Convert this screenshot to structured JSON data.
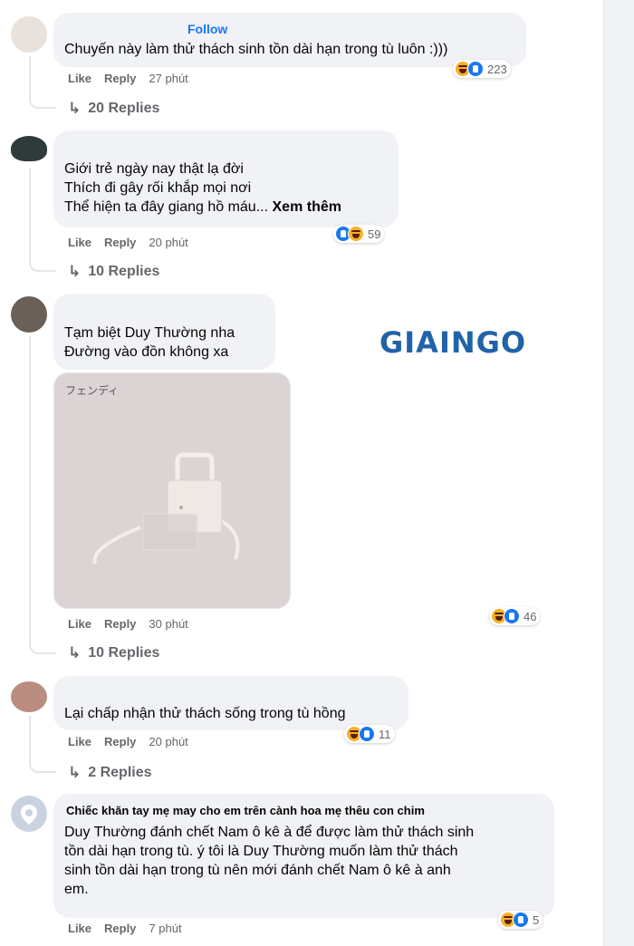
{
  "comments": [
    {
      "follow": "Follow",
      "lines": [
        "Chuyến này làm thử thách sinh tồn dài hạn trong tù luôn :)))"
      ],
      "actions": {
        "like": "Like",
        "reply": "Reply",
        "time": "27 phút"
      },
      "reactions": {
        "icons": [
          "haha-icon",
          "like-icon"
        ],
        "count": "223"
      },
      "replies": "20 Replies"
    },
    {
      "lines": [
        "Giới trẻ ngày nay thật lạ đời",
        "Thích đi gây rối khắp mọi nơi",
        "Thể hiện ta đây giang hồ máu..."
      ],
      "see_more": "Xem thêm",
      "actions": {
        "like": "Like",
        "reply": "Reply",
        "time": "20 phút"
      },
      "reactions": {
        "icons": [
          "like-icon",
          "haha-icon"
        ],
        "count": "59"
      },
      "replies": "10 Replies"
    },
    {
      "lines": [
        "Tạm biệt Duy Thường nha",
        "Đường vào đồn không xa"
      ],
      "image_caption": "フェンディ",
      "actions": {
        "like": "Like",
        "reply": "Reply",
        "time": "30 phút"
      },
      "reactions": {
        "icons": [
          "haha-icon",
          "like-icon"
        ],
        "count": "46"
      },
      "replies": "10 Replies"
    },
    {
      "lines": [
        "Lại chấp nhận thử thách sống trong tù hồng"
      ],
      "actions": {
        "like": "Like",
        "reply": "Reply",
        "time": "20 phút"
      },
      "reactions": {
        "icons": [
          "haha-icon",
          "like-icon"
        ],
        "count": "11"
      },
      "replies": "2 Replies"
    },
    {
      "name": "Chiếc khăn tay mẹ may cho em trên cành hoa mẹ thêu con chim",
      "lines": [
        "Duy Thường đánh chết Nam ô kê à để được làm thử thách sinh",
        "tồn dài hạn trong tù. ý tôi là Duy Thường muốn làm thử thách",
        "sinh tồn dài hạn trong tù nên mới đánh chết Nam ô kê à anh",
        "em."
      ],
      "actions": {
        "like": "Like",
        "reply": "Reply",
        "time": "7 phút"
      },
      "reactions": {
        "icons": [
          "haha-icon",
          "like-icon"
        ],
        "count": "5"
      }
    }
  ],
  "watermark": {
    "logo": "GIAINGO"
  }
}
